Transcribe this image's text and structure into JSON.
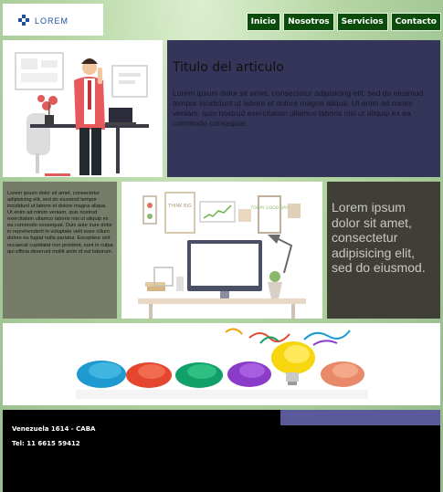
{
  "header": {
    "logo": {
      "text": "LOREM",
      "color": "#1d4f9a"
    },
    "nav": [
      {
        "label": "Inicio"
      },
      {
        "label": "Nosotros"
      },
      {
        "label": "Servicios"
      },
      {
        "label": "Contacto"
      }
    ]
  },
  "article": {
    "title": "Titulo del articulo",
    "body": "Lorem ipsum dolor sit amet, consectetur adipisicing elit, sed do eiusmod tempor incididunt ut labore et dolore magna aliqua. Ut enim ad minim veniam, quis nostrud exercitation ullamco laboris nisi ut aliquip ex ea commodo consequat."
  },
  "left_column": {
    "text": "Lorem ipsum dolor sit amet, consectetur adipisicing elit, sed do eiusmod tempor incididunt ut labore et dolore magna aliqua. Ut enim ad minim veniam, quis nostrud exercitation ullamco laboris nisi ut aliquip ex ea commodo consequat. Duis aute irure dolor in reprehenderit in voluptate velit esse cillum dolore eu fugiat nulla pariatur. Excepteur sint occaecat cupidatat non proident, sunt in culpa qui officia deserunt mollit anim id est laborum."
  },
  "right_column": {
    "text": "Lorem ipsum dolor sit amet, consectetur adipisicing elit, sed do eiusmod."
  },
  "office_card": {
    "frame_text": [
      "THINK BIG",
      "TODAY GOOD DAY"
    ]
  },
  "footer": {
    "address": "Venezuela 1614 - CABA",
    "phone": "Tel: 11 6615 59412"
  },
  "colors": {
    "nav_bg": "#0b4c0b",
    "article_bg": "#35355a",
    "left_col_bg": "#757d68",
    "right_col_bg": "#3f3f38",
    "footer_bg": "#000000",
    "footer_accent": "#5a5a9a"
  }
}
